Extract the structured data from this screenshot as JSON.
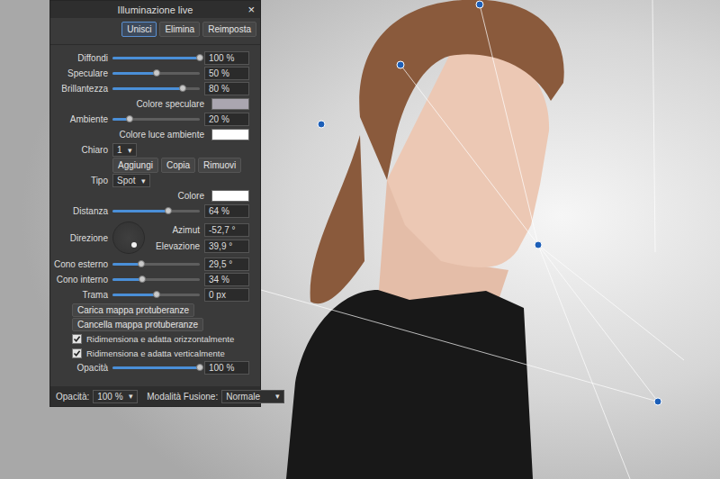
{
  "window": {
    "title": "Illuminazione live",
    "close": "×"
  },
  "actions": [
    {
      "label": "Unisci",
      "selected": true
    },
    {
      "label": "Elimina",
      "selected": false
    },
    {
      "label": "Reimposta",
      "selected": false
    }
  ],
  "rows": [
    {
      "kind": "slider",
      "label": "Diffondi",
      "level": 1,
      "reading": "100 %"
    },
    {
      "kind": "slider",
      "label": "Speculare",
      "level": 0.5,
      "reading": "50 %"
    },
    {
      "kind": "slider",
      "label": "Brillantezza",
      "level": 0.8,
      "reading": "80 %"
    },
    {
      "kind": "swatch",
      "label": "Colore speculare",
      "value": "#aaa6b0"
    },
    {
      "kind": "slider",
      "label": "Ambiente",
      "level": 0.2,
      "reading": "20 %"
    },
    {
      "kind": "swatch",
      "label": "Colore luce ambiente",
      "value": "#ffffff"
    },
    {
      "kind": "dropdown",
      "label": "Chiaro",
      "value": "1",
      "arrow": "▾"
    },
    {
      "kind": "buttons",
      "buttons": [
        "Aggiungi",
        "Copia",
        "Rimuovi"
      ]
    },
    {
      "kind": "dropdown",
      "label": "Tipo",
      "value": "Spot",
      "arrow": "▾"
    },
    {
      "kind": "swatch",
      "label": "Colore",
      "value": "#ffffff"
    },
    {
      "kind": "slider",
      "label": "Distanza",
      "level": 0.64,
      "reading": "64 %"
    },
    {
      "kind": "dial",
      "label": "Direzione",
      "fields": [
        {
          "label": "Azimut",
          "value": "-52,7 °"
        },
        {
          "label": "Elevazione",
          "value": "39,9 °"
        }
      ]
    },
    {
      "kind": "slider",
      "label": "Cono esterno",
      "level": 0.33,
      "reading": "29,5 °"
    },
    {
      "kind": "slider",
      "label": "Cono interno",
      "level": 0.34,
      "reading": "34 %"
    },
    {
      "kind": "slider",
      "label": "Trama",
      "level": 0.5,
      "reading": "0 px"
    },
    {
      "kind": "button",
      "label": "Carica mappa protuberanze"
    },
    {
      "kind": "button",
      "label": "Cancella mappa protuberanze"
    },
    {
      "kind": "checkbox",
      "label": "Ridimensiona e adatta orizzontalmente",
      "checked": true
    },
    {
      "kind": "checkbox",
      "label": "Ridimensiona e adatta verticalmente",
      "checked": true
    },
    {
      "kind": "slider",
      "label": "Opacità",
      "level": 1,
      "reading": "100 %"
    }
  ],
  "footer": {
    "opacity": {
      "label": "Opacità:",
      "value": "100 %",
      "arrow": "▾"
    },
    "blend": {
      "label": "Modalità Fusione:",
      "value": "Normale",
      "arrow": "▾"
    }
  }
}
